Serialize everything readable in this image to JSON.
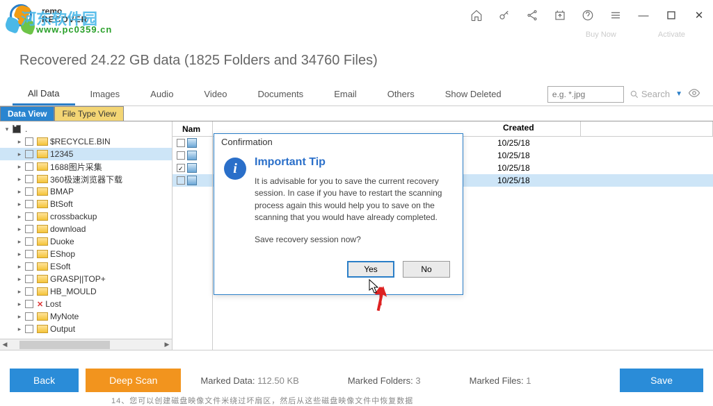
{
  "logo": {
    "line1": "remo",
    "line2": "RECOVER"
  },
  "watermark": {
    "text": "河东软件园",
    "url": "www.pc0359.cn"
  },
  "promo": {
    "buy": "Buy Now",
    "activate": "Activate"
  },
  "summary": "Recovered 24.22 GB data (1825 Folders and 34760 Files)",
  "tabs": [
    "All Data",
    "Images",
    "Audio",
    "Video",
    "Documents",
    "Email",
    "Others",
    "Show Deleted"
  ],
  "search": {
    "placeholder": "e.g. *.jpg",
    "label": "Search"
  },
  "view_tabs": {
    "data": "Data View",
    "file": "File Type View"
  },
  "tree": {
    "root": ".",
    "items": [
      {
        "name": "$RECYCLE.BIN"
      },
      {
        "name": "12345",
        "selected": true
      },
      {
        "name": "1688图片采集"
      },
      {
        "name": "360极速浏览器下载"
      },
      {
        "name": "BMAP"
      },
      {
        "name": "BtSoft"
      },
      {
        "name": "crossbackup"
      },
      {
        "name": "download"
      },
      {
        "name": "Duoke"
      },
      {
        "name": "EShop"
      },
      {
        "name": "ESoft"
      },
      {
        "name": "GRASP||TOP+"
      },
      {
        "name": "HB_MOULD"
      },
      {
        "name": "Lost",
        "deleted": true
      },
      {
        "name": "MyNote"
      },
      {
        "name": "Output"
      }
    ]
  },
  "mid": {
    "header": "Nam",
    "rows": [
      {
        "checked": false
      },
      {
        "checked": false
      },
      {
        "checked": true
      },
      {
        "checked": false,
        "selected": true
      }
    ]
  },
  "right": {
    "header": "Created",
    "rows": [
      "10/25/18",
      "10/25/18",
      "10/25/18",
      "10/25/18"
    ]
  },
  "dialog": {
    "title": "Confirmation",
    "heading": "Important Tip",
    "body": "It is advisable for you to save the current recovery session. In case if you have to restart the scanning process again this would help you to save on the scanning that you would have already completed.",
    "question": "Save recovery session now?",
    "yes": "Yes",
    "no": "No"
  },
  "footer": {
    "back": "Back",
    "deep": "Deep Scan",
    "marked_data_label": "Marked Data: ",
    "marked_data": "112.50 KB",
    "marked_folders_label": "Marked Folders: ",
    "marked_folders": "3",
    "marked_files_label": "Marked Files: ",
    "marked_files": "1",
    "save": "Save"
  },
  "bottom_cut": "14、您可以创建磁盘映像文件米绕过坏扇区，然后从这些磁盘映像文件中恢复数据"
}
